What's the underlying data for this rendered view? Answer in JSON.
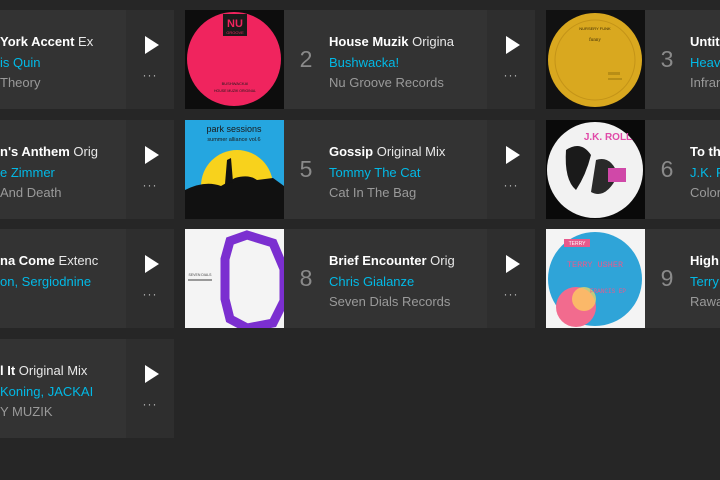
{
  "tracks": [
    {
      "rank": "",
      "title": "York Accent",
      "mix": "Ex",
      "artist": "is Quin",
      "label": "Theory"
    },
    {
      "rank": "2",
      "title": "House Muzik",
      "mix": "Origina",
      "artist": "Bushwacka!",
      "label": "Nu Groove Records"
    },
    {
      "rank": "3",
      "title": "Untit",
      "mix": "",
      "artist": "Heav",
      "label": "Infran"
    },
    {
      "rank": "",
      "title": "n's Anthem",
      "mix": "Orig",
      "artist": "e Zimmer",
      "label": "And Death"
    },
    {
      "rank": "5",
      "title": "Gossip",
      "mix": "Original Mix",
      "artist": "Tommy The Cat",
      "label": "Cat In The Bag"
    },
    {
      "rank": "6",
      "title": "To th",
      "mix": "",
      "artist": "J.K. R",
      "label": "Color"
    },
    {
      "rank": "",
      "title": "na Come",
      "mix": "Extenc",
      "artist": "on, Sergiodnine",
      "label": ""
    },
    {
      "rank": "8",
      "title": "Brief Encounter",
      "mix": "Orig",
      "artist": "Chris Gialanze",
      "label": "Seven Dials Records"
    },
    {
      "rank": "9",
      "title": "High",
      "mix": "",
      "artist": "Terry",
      "label": "Rawa"
    },
    {
      "rank": "",
      "title": "l It",
      "mix": "Original Mix",
      "artist": "Koning, JACKAI",
      "label": "Y MUZIK"
    }
  ],
  "artwork": {
    "a2": {
      "line1": "NU",
      "line2": "GROOVE",
      "tiny": "BUSHWACKA!",
      "tiny2": "HOUSE MUZIK ORIGINAL"
    },
    "a3": {
      "brand": "NURSERY FUNK",
      "sub": "funny"
    },
    "a5": {
      "line1": "park sessions",
      "line2": "summer alliance vol.6"
    },
    "a6": {
      "text": "J.K. ROLL"
    },
    "a8": {
      "text": "SEVEN DIALS"
    },
    "a9": {
      "top": "TERRY",
      "name": "TERRY USHER",
      "ep": "FRANCIS EP"
    }
  },
  "colors": {
    "artist": "#02b9e6",
    "card": "#333333",
    "bg": "#262626"
  }
}
